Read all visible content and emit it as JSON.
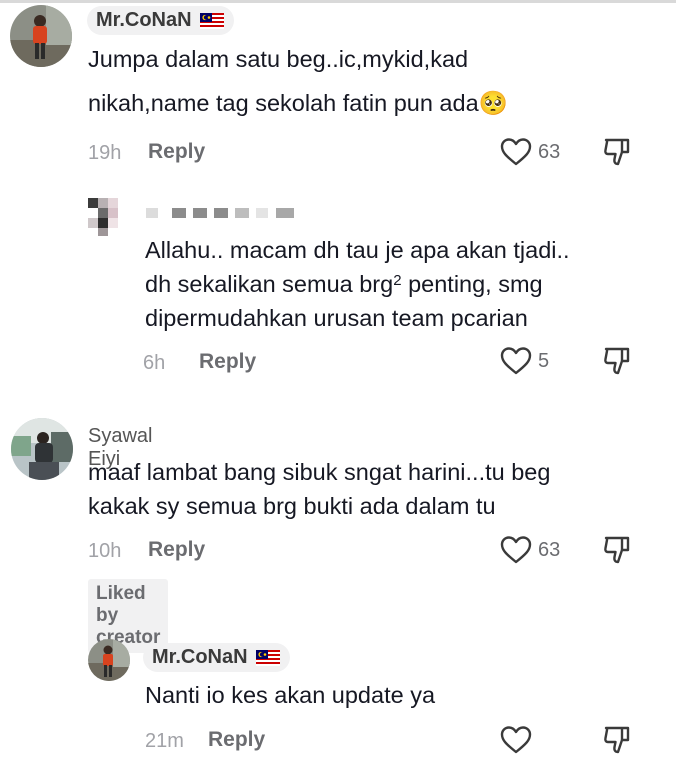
{
  "comments": [
    {
      "username": "Mr.CoNaN",
      "text_line1": "Jumpa dalam satu beg..ic,mykid,kad",
      "text_line2": "nikah,name tag sekolah fatin pun ada",
      "emoji": "🥺",
      "time": "19h",
      "reply_label": "Reply",
      "likes": "63"
    },
    {
      "username": "",
      "text_line1": "Allahu.. macam dh tau je apa akan tjadi..",
      "text_line2_pre": "dh sekalikan semua brg",
      "text_line2_sup": "2",
      "text_line2_post": " penting, smg",
      "text_line3": "dipermudahkan urusan team pcarian",
      "time": "6h",
      "reply_label": "Reply",
      "likes": "5"
    },
    {
      "username": "Syawal Eiyi",
      "text_line1": "maaf lambat bang sibuk sngat harini...tu beg",
      "text_line2": "kakak sy semua brg bukti ada dalam tu",
      "time": "10h",
      "reply_label": "Reply",
      "likes": "63",
      "badge": "Liked by creator"
    },
    {
      "username": "Mr.CoNaN",
      "text_line1": "Nanti io kes akan update ya",
      "time": "21m",
      "reply_label": "Reply",
      "likes": ""
    }
  ],
  "icons": {
    "like": "heart-outline-icon",
    "dislike": "thumbs-down-icon",
    "flag": "malaysia-flag-icon"
  },
  "colors": {
    "text": "#161823",
    "muted": "#a1a2a7",
    "pill": "#f1f1f2"
  }
}
